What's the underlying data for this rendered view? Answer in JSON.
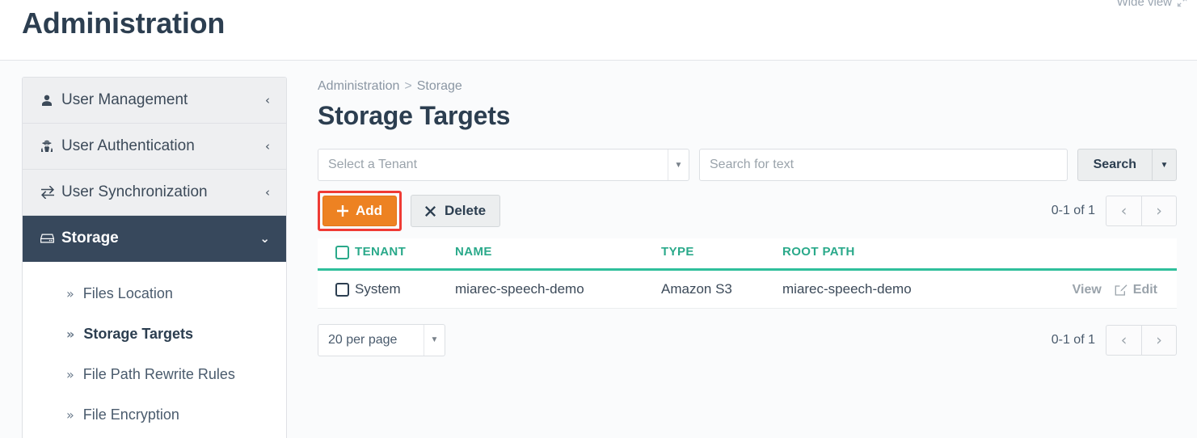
{
  "header": {
    "title": "Administration",
    "wide_view_label": "Wide view",
    "wide_view_icon": "expand-arrows-icon"
  },
  "sidebar": {
    "groups": [
      {
        "label": "User Management",
        "icon": "user-icon",
        "caret": "chevron-left-icon",
        "active": false
      },
      {
        "label": "User Authentication",
        "icon": "user-secret-icon",
        "caret": "chevron-left-icon",
        "active": false
      },
      {
        "label": "User Synchronization",
        "icon": "exchange-arrows-icon",
        "caret": "chevron-left-icon",
        "active": false
      },
      {
        "label": "Storage",
        "icon": "hard-drive-icon",
        "caret": "chevron-down-icon",
        "active": true
      }
    ],
    "sub_items": [
      {
        "label": "Files Location",
        "active": false
      },
      {
        "label": "Storage Targets",
        "active": true
      },
      {
        "label": "File Path Rewrite Rules",
        "active": false
      },
      {
        "label": "File Encryption",
        "active": false
      }
    ],
    "sub_chevron": "double-angle-right-icon"
  },
  "breadcrumb": {
    "root": "Administration",
    "separator": ">",
    "current": "Storage"
  },
  "main": {
    "page_title": "Storage Targets"
  },
  "filters": {
    "tenant_select_value": "Select a Tenant",
    "tenant_select_placeholder": "Select a Tenant",
    "search_value": "",
    "search_placeholder": "Search for text",
    "search_button_label": "Search",
    "search_caret_icon": "caret-down-icon",
    "select_caret_icon": "caret-down-icon"
  },
  "actions": {
    "add_label": "Add",
    "add_icon": "plus-icon",
    "delete_label": "Delete",
    "delete_icon": "times-icon",
    "add_highlight_color": "#ef3b35",
    "add_button_color": "#ed8222"
  },
  "pagination_top": {
    "count_label": "0-1 of 1",
    "prev_icon": "chevron-left-icon",
    "next_icon": "chevron-right-icon"
  },
  "pagination_bottom": {
    "count_label": "0-1 of 1",
    "prev_icon": "chevron-left-icon",
    "next_icon": "chevron-right-icon",
    "per_page_value": "20 per page",
    "per_page_caret_icon": "caret-down-icon"
  },
  "table": {
    "header_color": "#2aa98a",
    "columns": [
      "TENANT",
      "NAME",
      "TYPE",
      "ROOT PATH"
    ],
    "select_all_checkbox": false,
    "rows": [
      {
        "selected": false,
        "tenant": "System",
        "name": "miarec-speech-demo",
        "type": "Amazon S3",
        "root_path": "miarec-speech-demo",
        "view_label": "View",
        "edit_label": "Edit",
        "edit_icon": "pencil-square-icon"
      }
    ]
  }
}
